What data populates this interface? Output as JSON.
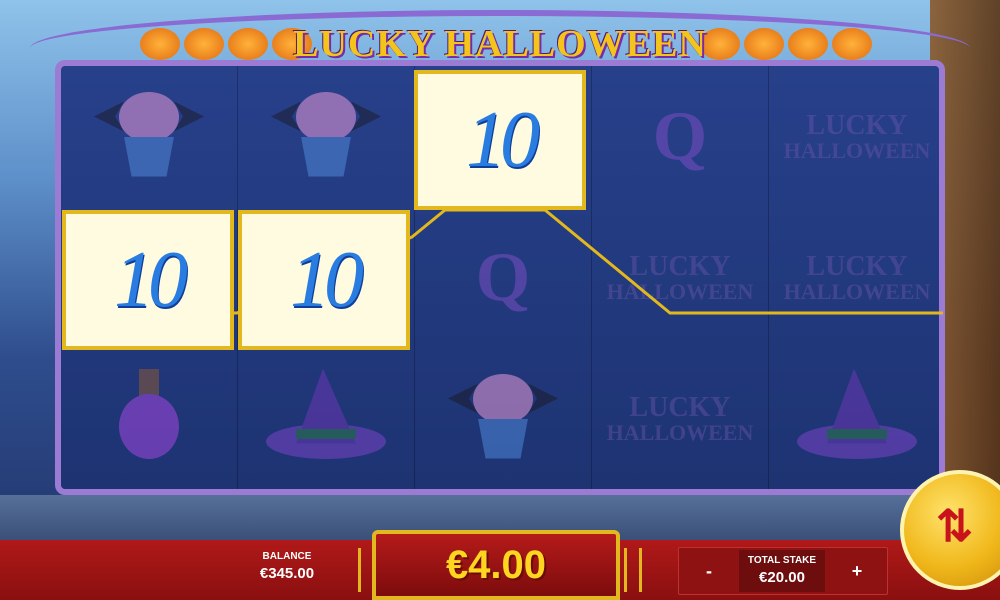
{
  "game": {
    "title": "LUCKY HALLOWEEN"
  },
  "reels": [
    [
      "cupcake",
      "ten",
      "potion"
    ],
    [
      "cupcake",
      "ten",
      "witch-hat"
    ],
    [
      "ten",
      "queen",
      "cupcake"
    ],
    [
      "queen",
      "logo",
      "logo"
    ],
    [
      "logo",
      "logo",
      "witch-hat"
    ]
  ],
  "symbols": {
    "ten": "10",
    "queen": "Q",
    "logo_line1": "LUCKY",
    "logo_line2": "HALLOWEEN"
  },
  "balance": {
    "label": "BALANCE",
    "value": "€345.00"
  },
  "win": {
    "amount": "€4.00"
  },
  "stake": {
    "label": "TOTAL STAKE",
    "value": "€20.00",
    "minus": "-",
    "plus": "+"
  },
  "colors": {
    "accent": "#e2b81e",
    "bar": "#b01919",
    "win_text": "#ffd61f"
  },
  "icons": {
    "spin": "spin-arrows-icon"
  }
}
